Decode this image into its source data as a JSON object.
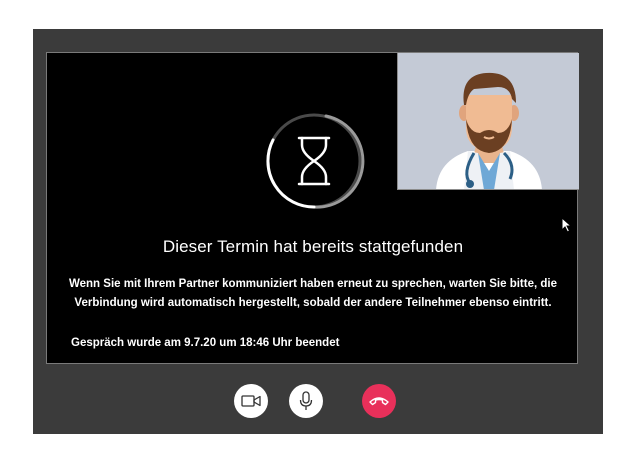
{
  "status": {
    "title": "Dieser Termin hat bereits stattgefunden",
    "message_line1": "Wenn Sie mit Ihrem Partner kommuniziert haben erneut zu sprechen, warten Sie bitte, die",
    "message_line2": "Verbindung wird automatisch hergestellt, sobald der andere Teilnehmer ebenso eintritt.",
    "ended_text": "Gespräch wurde am 9.7.20 um 18:46 Uhr beendet"
  },
  "controls": {
    "camera_icon": "video-camera-icon",
    "mic_icon": "microphone-icon",
    "hangup_icon": "phone-hangup-icon"
  },
  "colors": {
    "frame": "#3b3b3b",
    "video_bg": "#000000",
    "pip_bg": "#c4cad6",
    "hangup": "#e8305a",
    "control_bg": "#ffffff"
  }
}
